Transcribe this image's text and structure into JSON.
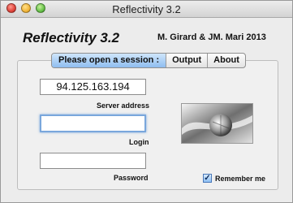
{
  "window": {
    "title": "Reflectivity 3.2"
  },
  "header": {
    "app_title": "Reflectivity 3.2",
    "author": "M. Girard & JM. Mari 2013"
  },
  "tabs": [
    {
      "label": "Please open a session :",
      "active": true
    },
    {
      "label": "Output",
      "active": false
    },
    {
      "label": "About",
      "active": false
    }
  ],
  "form": {
    "server_value": "94.125.163.194",
    "server_label": "Server address",
    "login_value": "",
    "login_label": "Login",
    "password_value": "",
    "password_label": "Password",
    "remember_label": "Remember me",
    "remember_checked": true
  }
}
